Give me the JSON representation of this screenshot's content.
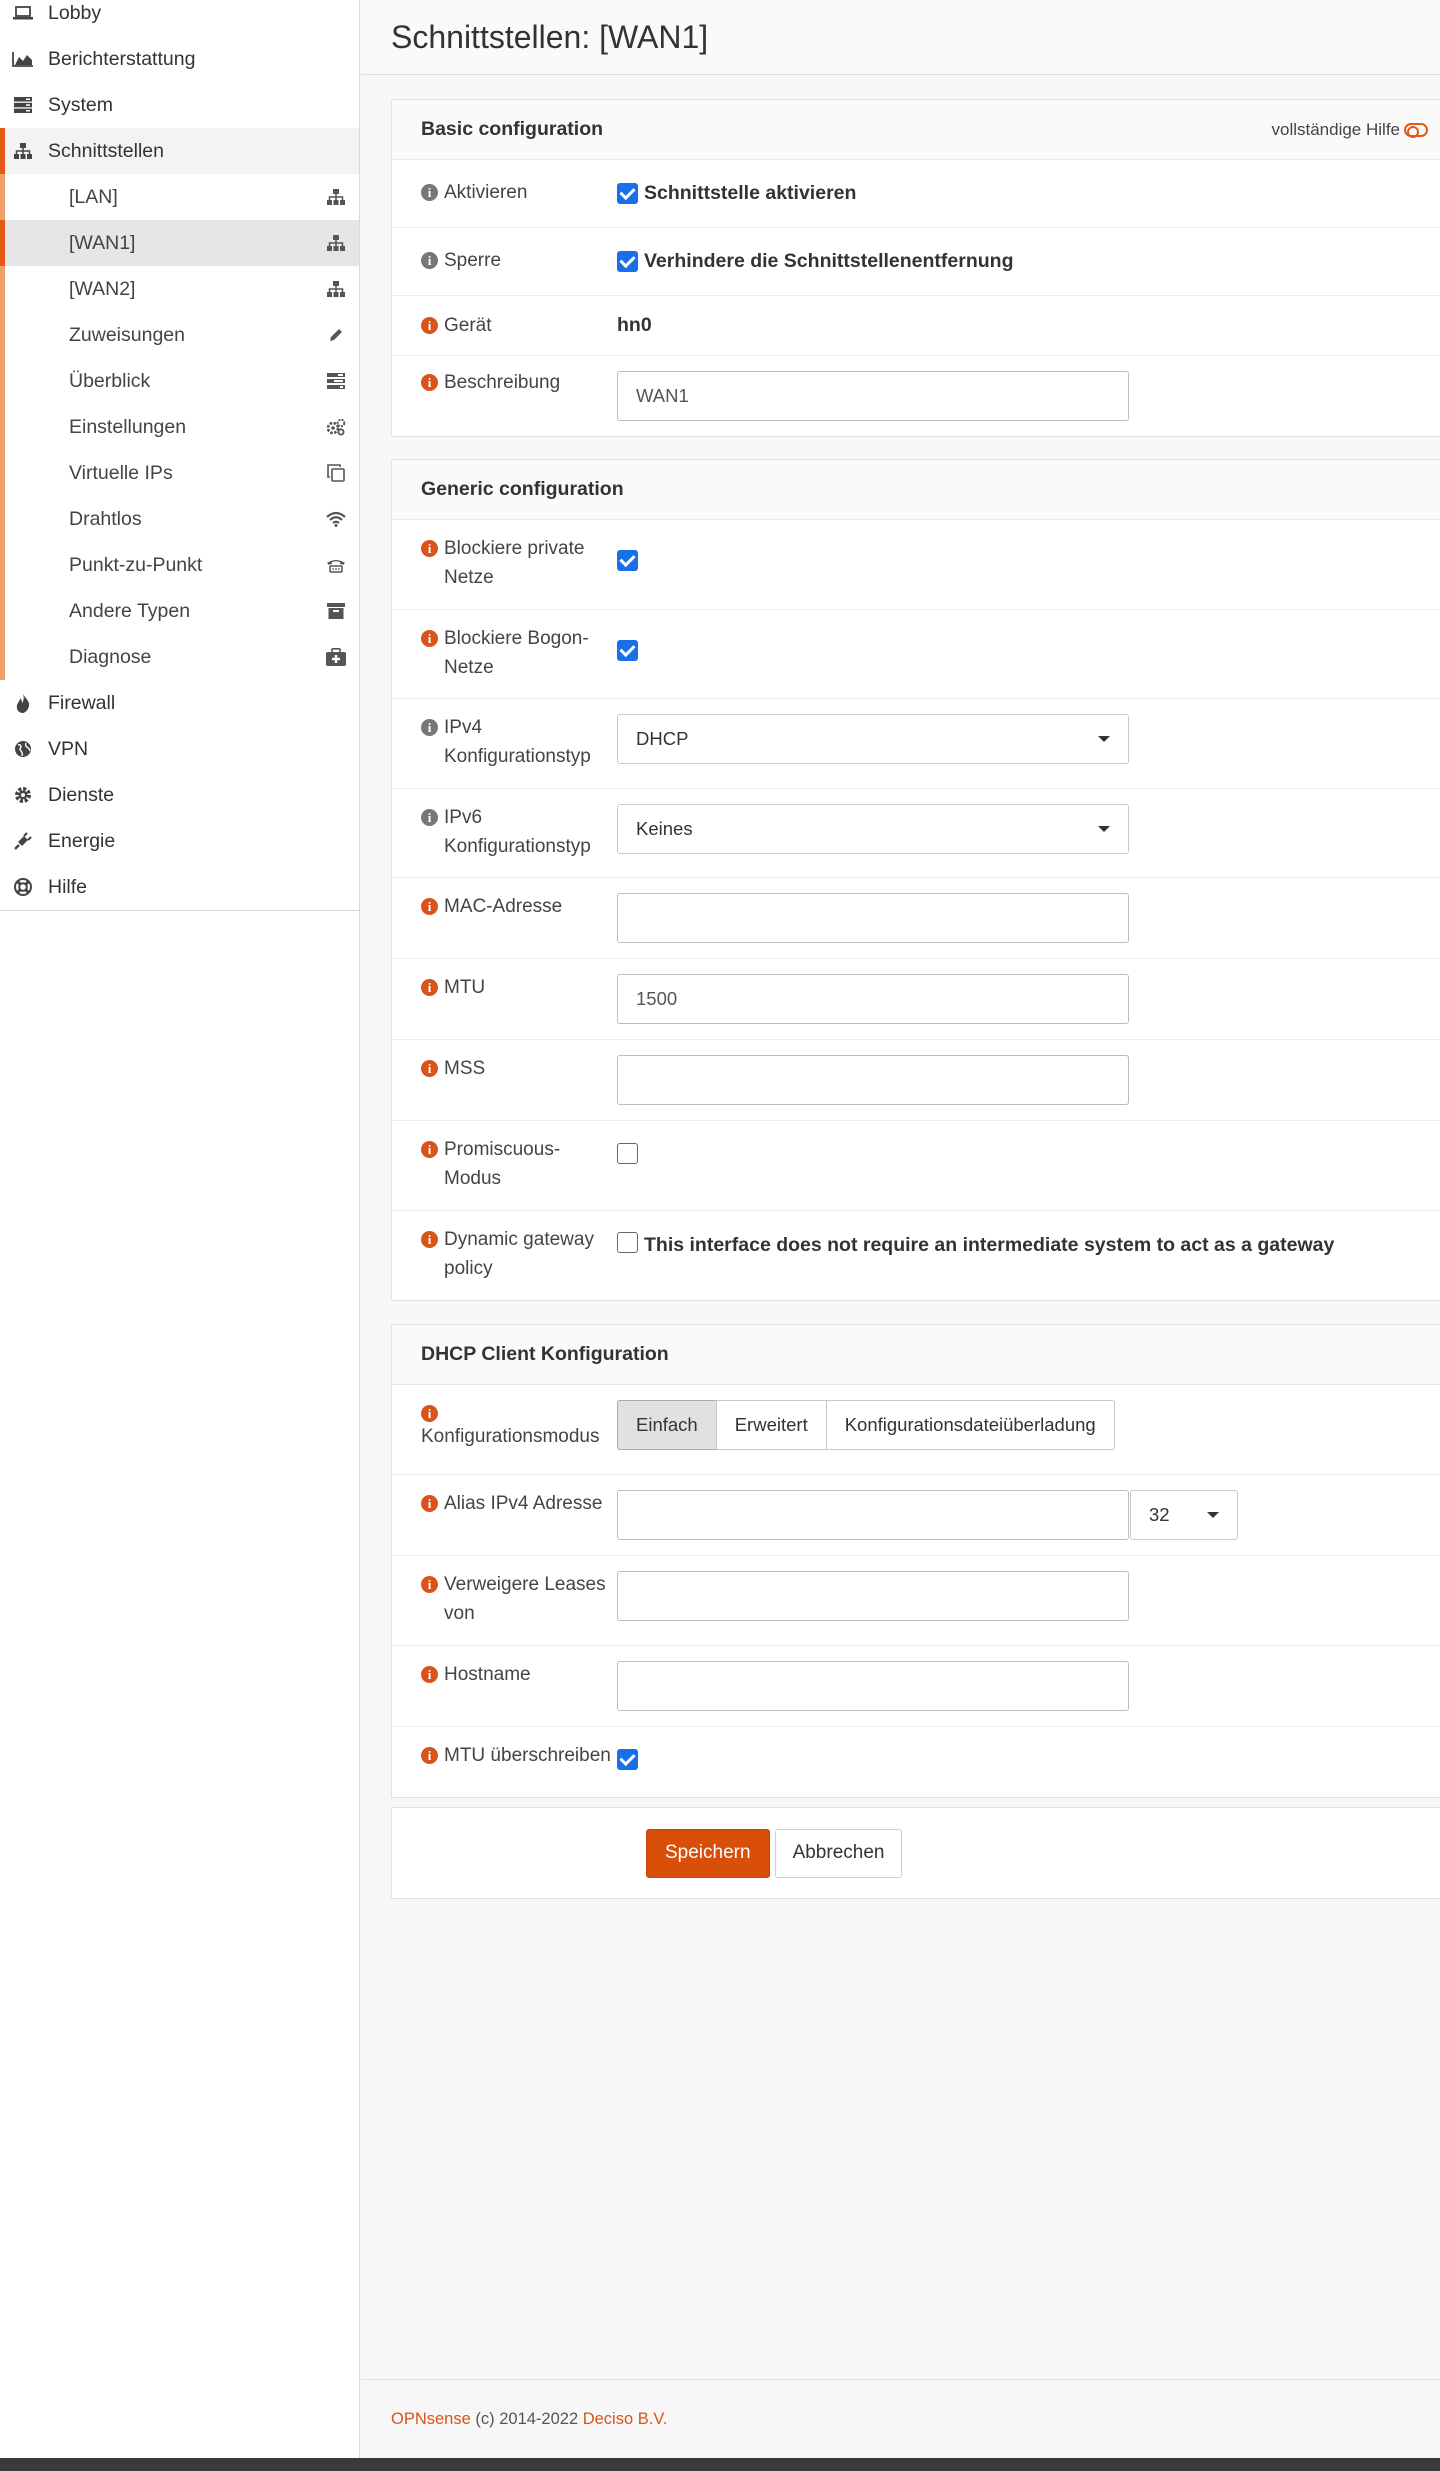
{
  "sidebar": {
    "items": [
      {
        "label": "Lobby",
        "icon": "laptop-icon"
      },
      {
        "label": "Berichterstattung",
        "icon": "area-chart-icon"
      },
      {
        "label": "System",
        "icon": "server-icon"
      },
      {
        "label": "Schnittstellen",
        "icon": "sitemap-icon"
      }
    ],
    "sub_items": [
      {
        "label": "[LAN]",
        "icon": "sitemap-icon"
      },
      {
        "label": "[WAN1]",
        "icon": "sitemap-icon"
      },
      {
        "label": "[WAN2]",
        "icon": "sitemap-icon"
      },
      {
        "label": "Zuweisungen",
        "icon": "pencil-icon"
      },
      {
        "label": "Überblick",
        "icon": "tasks-icon"
      },
      {
        "label": "Einstellungen",
        "icon": "cogs-icon"
      },
      {
        "label": "Virtuelle IPs",
        "icon": "clone-icon"
      },
      {
        "label": "Drahtlos",
        "icon": "wifi-icon"
      },
      {
        "label": "Punkt-zu-Punkt",
        "icon": "phone-icon"
      },
      {
        "label": "Andere Typen",
        "icon": "archive-icon"
      },
      {
        "label": "Diagnose",
        "icon": "medkit-icon"
      }
    ],
    "bottom_items": [
      {
        "label": "Firewall",
        "icon": "fire-icon"
      },
      {
        "label": "VPN",
        "icon": "globe-icon"
      },
      {
        "label": "Dienste",
        "icon": "cog-icon"
      },
      {
        "label": "Energie",
        "icon": "plug-icon"
      },
      {
        "label": "Hilfe",
        "icon": "life-ring-icon"
      }
    ]
  },
  "page": {
    "title": "Schnittstellen: [WAN1]"
  },
  "basic": {
    "title": "Basic configuration",
    "help_toggle": "vollständige Hilfe",
    "enable_label": "Aktivieren",
    "enable_text": "Schnittstelle aktivieren",
    "lock_label": "Sperre",
    "lock_text": "Verhindere die Schnittstellenentfernung",
    "device_label": "Gerät",
    "device_value": "hn0",
    "description_label": "Beschreibung",
    "description_value": "WAN1"
  },
  "generic": {
    "title": "Generic configuration",
    "block_private_label": "Blockiere private Netze",
    "block_bogon_label": "Blockiere Bogon-Netze",
    "ipv4_label": "IPv4 Konfigurationstyp",
    "ipv4_value": "DHCP",
    "ipv6_label": "IPv6 Konfigurationstyp",
    "ipv6_value": "Keines",
    "mac_label": "MAC-Adresse",
    "mac_value": "",
    "mtu_label": "MTU",
    "mtu_value": "1500",
    "mss_label": "MSS",
    "mss_value": "",
    "promisc_label": "Promiscuous-Modus",
    "dyn_gw_label": "Dynamic gateway policy",
    "dyn_gw_text": "This interface does not require an intermediate system to act as a gateway"
  },
  "dhcp": {
    "title": "DHCP Client Konfiguration",
    "mode_label": "Konfigurationsmodus",
    "modes": [
      "Einfach",
      "Erweitert",
      "Konfigurationsdateiüberladung"
    ],
    "alias_label": "Alias IPv4 Adresse",
    "alias_value": "",
    "alias_prefix": "32",
    "reject_label": "Verweigere Leases von",
    "reject_value": "",
    "hostname_label": "Hostname",
    "hostname_value": "",
    "override_mtu_label": "MTU überschreiben"
  },
  "actions": {
    "save": "Speichern",
    "cancel": "Abbrechen"
  },
  "footer": {
    "brand": "OPNsense",
    "copyright": "(c) 2014-2022",
    "company": "Deciso B.V."
  },
  "colors": {
    "accent": "#d94f0a",
    "checkbox": "#1a6fe8"
  }
}
